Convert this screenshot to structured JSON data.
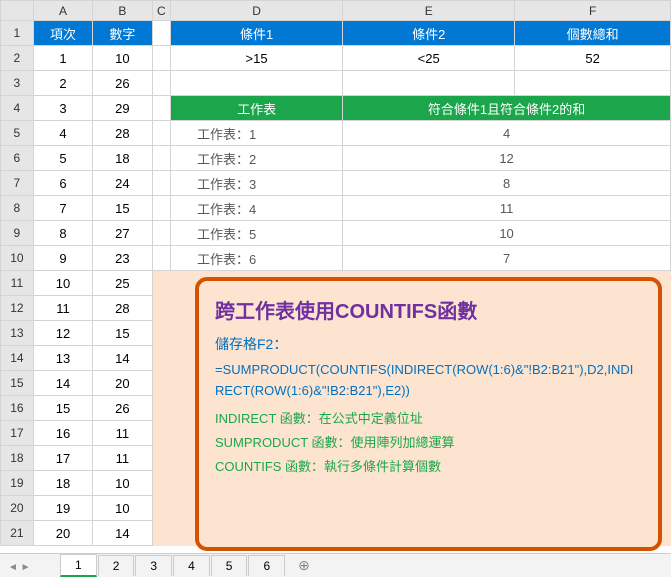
{
  "columns": [
    "A",
    "B",
    "C",
    "D",
    "E",
    "F"
  ],
  "row_numbers": [
    1,
    2,
    3,
    4,
    5,
    6,
    7,
    8,
    9,
    10,
    11,
    12,
    13,
    14,
    15,
    16,
    17,
    18,
    19,
    20,
    21
  ],
  "headers": {
    "item": "項次",
    "number": "數字",
    "cond1": "條件1",
    "cond2": "條件2",
    "count_sum": "個數總和",
    "worksheet": "工作表",
    "sum_match": "符合條件1且符合條件2的和"
  },
  "conditions": {
    "cond1_val": ">15",
    "cond2_val": "<25",
    "result": "52"
  },
  "left_data": [
    {
      "n": "1",
      "v": "10"
    },
    {
      "n": "2",
      "v": "26"
    },
    {
      "n": "3",
      "v": "29"
    },
    {
      "n": "4",
      "v": "28"
    },
    {
      "n": "5",
      "v": "18"
    },
    {
      "n": "6",
      "v": "24"
    },
    {
      "n": "7",
      "v": "15"
    },
    {
      "n": "8",
      "v": "27"
    },
    {
      "n": "9",
      "v": "23"
    },
    {
      "n": "10",
      "v": "25"
    },
    {
      "n": "11",
      "v": "28"
    },
    {
      "n": "12",
      "v": "15"
    },
    {
      "n": "13",
      "v": "14"
    },
    {
      "n": "14",
      "v": "20"
    },
    {
      "n": "15",
      "v": "26"
    },
    {
      "n": "16",
      "v": "11"
    },
    {
      "n": "17",
      "v": "11"
    },
    {
      "n": "18",
      "v": "10"
    },
    {
      "n": "19",
      "v": "10"
    },
    {
      "n": "20",
      "v": "14"
    }
  ],
  "sheet_rows": [
    {
      "label": "工作表：1",
      "val": "4"
    },
    {
      "label": "工作表：2",
      "val": "12"
    },
    {
      "label": "工作表：3",
      "val": "8"
    },
    {
      "label": "工作表：4",
      "val": "11"
    },
    {
      "label": "工作表：5",
      "val": "10"
    },
    {
      "label": "工作表：6",
      "val": "7"
    }
  ],
  "info": {
    "title": "跨工作表使用COUNTIFS函數",
    "cell_ref": "儲存格F2：",
    "formula": "=SUMPRODUCT(COUNTIFS(INDIRECT(ROW(1:6)&\"!B2:B21\"),D2,INDIRECT(ROW(1:6)&\"!B2:B21\"),E2))",
    "desc1": "INDIRECT 函數：在公式中定義位址",
    "desc2": "SUMPRODUCT 函數：使用陣列加總運算",
    "desc3": "COUNTIFS 函數：執行多條件計算個數"
  },
  "tabs": [
    "1",
    "2",
    "3",
    "4",
    "5",
    "6"
  ],
  "active_tab": "1",
  "add_icon": "⊕"
}
